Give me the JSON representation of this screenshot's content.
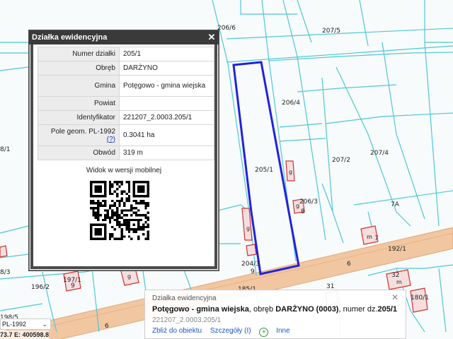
{
  "map": {
    "parcel_labels": [
      "206/6",
      "207/5",
      "206/4",
      "207/2",
      "207/4",
      "205/1",
      "206/3",
      "192/1",
      "204/3",
      "196/2",
      "197/1",
      "185/1",
      "180/1",
      "8/1",
      "8/3",
      "198/5"
    ],
    "road_labels": [
      "6",
      "6"
    ],
    "building_labels": [
      "g",
      "g",
      "g",
      "m",
      "g",
      "m",
      "8",
      "9",
      "7",
      "7A",
      "31",
      "32",
      "9"
    ],
    "colors": {
      "parcel_line": "#4ec7d4",
      "selected_parcel": "#2222dd",
      "road": "#f1c7a1",
      "building": "#cc3333",
      "address": "#3333cc"
    }
  },
  "dialog": {
    "title": "Działka ewidencyjna",
    "close_icon": "close-icon",
    "rows": [
      {
        "key": "Numer działki",
        "value": "205/1"
      },
      {
        "key": "Obręb",
        "value": "DARŻYNO"
      },
      {
        "key": "Gmina",
        "value": "Potęgowo - gmina wiejska"
      },
      {
        "key": "Powiat",
        "value": ""
      },
      {
        "key": "Identyfikator",
        "value": "221207_2.0003.205/1"
      },
      {
        "key": "Pole geom. PL-1992",
        "key_link": "(?)",
        "value": "0.3041 ha"
      },
      {
        "key": "Obwód",
        "value": "319 m"
      }
    ],
    "mobile_caption": "Widok w wersji mobilnej"
  },
  "popup": {
    "header": "Działka ewidencyjna",
    "gmina": "Potęgowo - gmina wiejska",
    "obreb_text": ", obręb ",
    "obreb": "DARŻYNO (0003)",
    "numer_text": ", numer dz.",
    "numer": "205/1",
    "identifier": "221207_2.0003.205/1",
    "actions": {
      "zoom": "Zbliż do obiektu",
      "details": "Szczegóły (I)",
      "other": "Inne"
    }
  },
  "crs": {
    "selected": "PL-1992"
  },
  "coords": {
    "text": "73.7   E: 400598.8"
  }
}
